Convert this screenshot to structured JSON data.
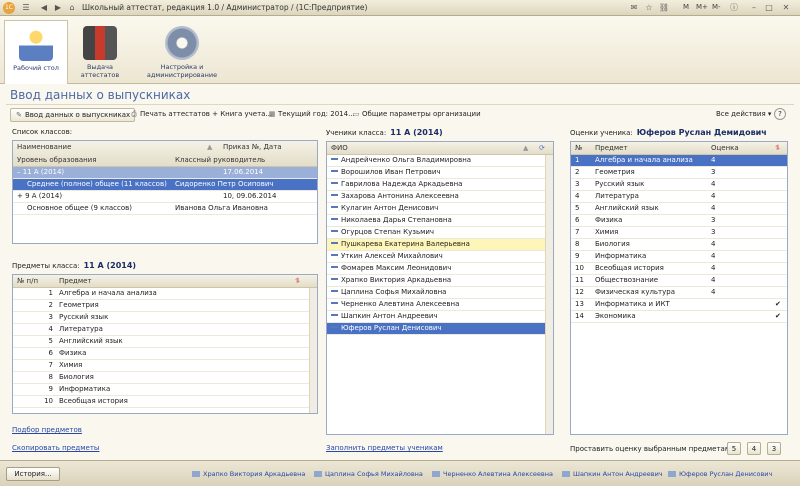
{
  "window": {
    "title": "Школьный аттестат, редакция 1.0 / Администратор / (1С:Предприятие)",
    "right_controls": [
      "M",
      "M+",
      "M-"
    ]
  },
  "nav": [
    {
      "label": "Рабочий стол",
      "icon": "desk-lamp-icon"
    },
    {
      "label": "Выдача аттестатов",
      "icon": "machine-icon"
    },
    {
      "label": "Настройка и администрирование",
      "icon": "gear-icon"
    }
  ],
  "page": {
    "title": "Ввод данных о выпускниках"
  },
  "toolbar": {
    "enter_data": "Ввод данных о выпускниках",
    "print": "Печать аттестатов + Книга учета...",
    "year": "Текущий год: 2014...",
    "org_params": "Общие параметры организации",
    "all_actions": "Все действия ▾",
    "help": "?"
  },
  "classes": {
    "label": "Список классов:",
    "headers": {
      "name": "Наименование",
      "order": "Приказ №, Дата",
      "level": "Уровень образования",
      "teacher": "Классный руководитель"
    },
    "rows": [
      {
        "name": "11 А (2014)",
        "order": "17.06.2014",
        "level": "Среднее (полное) общее (11 классов)",
        "teacher": "Сидоренко Петр Осипович"
      },
      {
        "name": "9 А (2014)",
        "order": "10, 09.06.2014",
        "level": "Основное общее (9 классов)",
        "teacher": "Иванова Ольга Ивановна"
      }
    ]
  },
  "subjects": {
    "label": "Предметы класса:",
    "class_name": "11 А (2014)",
    "headers": {
      "num": "№ п/п",
      "subject": "Предмет"
    },
    "rows": [
      {
        "n": "1",
        "s": "Алгебра и начала анализа"
      },
      {
        "n": "2",
        "s": "Геометрия"
      },
      {
        "n": "3",
        "s": "Русский язык"
      },
      {
        "n": "4",
        "s": "Литература"
      },
      {
        "n": "5",
        "s": "Английский язык"
      },
      {
        "n": "6",
        "s": "Физика"
      },
      {
        "n": "7",
        "s": "Химия"
      },
      {
        "n": "8",
        "s": "Биология"
      },
      {
        "n": "9",
        "s": "Информатика"
      },
      {
        "n": "10",
        "s": "Всеобщая история"
      }
    ],
    "link_select": "Подбор предметов",
    "link_copy": "Скопировать предметы"
  },
  "students": {
    "label": "Ученики класса:",
    "class_name": "11 А (2014)",
    "header": "ФИО",
    "rows": [
      "Андрейченко Ольга Владимировна",
      "Ворошилов Иван Петрович",
      "Гаврилова Надежда Аркадьевна",
      "Захарова Антонина Алексеевна",
      "Кулагин Антон Денисович",
      "Николаева Дарья Степановна",
      "Огурцов Степан Кузьмич",
      "Пушкарева Екатерина Валерьевна",
      "Уткин Алексей Михайлович",
      "Фомарев Максим Леонидович",
      "Храпко Виктория Аркадьевна",
      "Цаплина Софья Михайловна",
      "Черненко Алевтина Алексеевна",
      "Шапкин Антон Андреевич",
      "Юферов Руслан Денисович"
    ],
    "link_fill": "Заполнить предметы ученикам"
  },
  "grades": {
    "label": "Оценки ученика:",
    "student": "Юферов Руслан Демидович",
    "headers": {
      "num": "№",
      "subject": "Предмет",
      "grade": "Оценка"
    },
    "rows": [
      {
        "n": "1",
        "s": "Алгебра и начала анализа",
        "g": "4",
        "c": ""
      },
      {
        "n": "2",
        "s": "Геометрия",
        "g": "3",
        "c": ""
      },
      {
        "n": "3",
        "s": "Русский язык",
        "g": "4",
        "c": ""
      },
      {
        "n": "4",
        "s": "Литература",
        "g": "4",
        "c": ""
      },
      {
        "n": "5",
        "s": "Английский язык",
        "g": "4",
        "c": ""
      },
      {
        "n": "6",
        "s": "Физика",
        "g": "3",
        "c": ""
      },
      {
        "n": "7",
        "s": "Химия",
        "g": "3",
        "c": ""
      },
      {
        "n": "8",
        "s": "Биология",
        "g": "4",
        "c": ""
      },
      {
        "n": "9",
        "s": "Информатика",
        "g": "4",
        "c": ""
      },
      {
        "n": "10",
        "s": "Всеобщая история",
        "g": "4",
        "c": ""
      },
      {
        "n": "11",
        "s": "Обществознание",
        "g": "4",
        "c": ""
      },
      {
        "n": "12",
        "s": "Физическая культура",
        "g": "4",
        "c": ""
      },
      {
        "n": "13",
        "s": "Информатика и ИКТ",
        "g": "",
        "c": "✔"
      },
      {
        "n": "14",
        "s": "Экономика",
        "g": "",
        "c": "✔"
      }
    ],
    "set_label": "Проставить оценку выбранным предметам",
    "buttons": [
      "5",
      "4",
      "3"
    ]
  },
  "status": {
    "history": "История...",
    "items": [
      "Храпко Виктория Аркадьевна",
      "Цаплина Софья Михайловна",
      "Черненко Алевтина Алексеевна",
      "Шапкин Антон Андреевич",
      "Юферов Руслан Денисович"
    ]
  }
}
